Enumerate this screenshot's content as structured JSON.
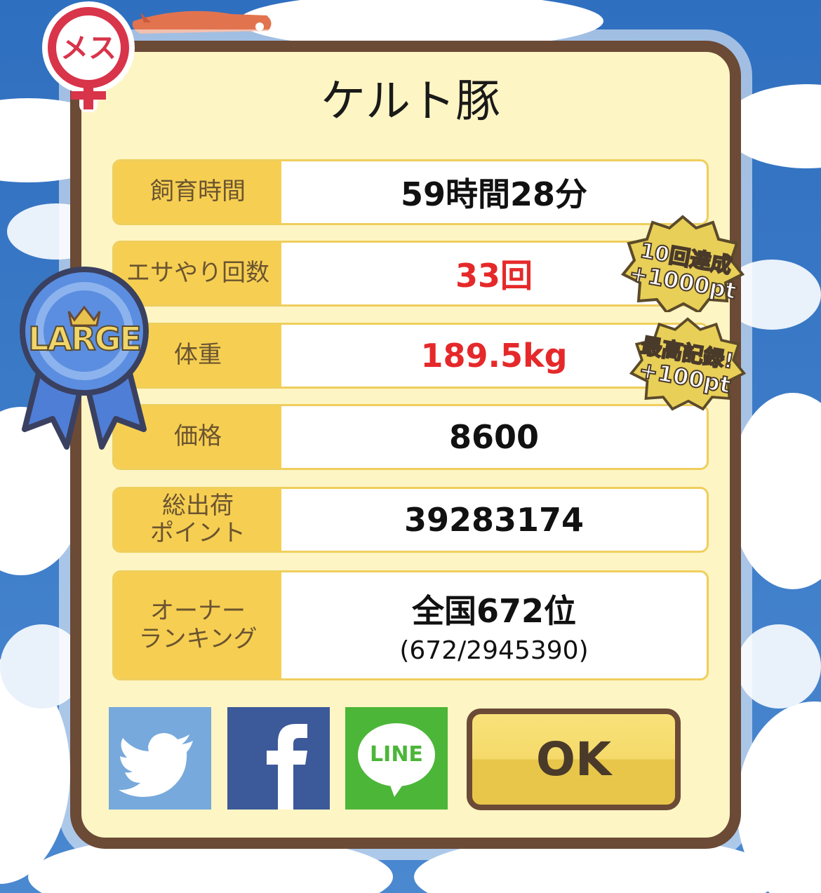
{
  "title": "ケルト豚",
  "gender_badge": "メス",
  "size_badge": "LARGE",
  "stats": [
    {
      "label": "飼育時間",
      "value": "59時間28分"
    },
    {
      "label": "エサやり回数",
      "value": "33回"
    },
    {
      "label": "体重",
      "value": "189.5kg"
    },
    {
      "label": "価格",
      "value": "8600"
    },
    {
      "label_line1": "総出荷",
      "label_line2": "ポイント",
      "value": "39283174"
    },
    {
      "label_line1": "オーナー",
      "label_line2": "ランキング",
      "value": "全国672位",
      "sub": "(672/2945390)"
    }
  ],
  "bonus_feed": {
    "line1": "10回達成",
    "line2": "+1000pt"
  },
  "bonus_weight": {
    "line1": "最高記録!",
    "line2": "+100pt"
  },
  "social": {
    "line": "LINE"
  },
  "ok_label": "OK",
  "colors": {
    "panel": "#fef5c4",
    "border": "#6b4a36",
    "label_bg": "#f6cf52",
    "highlight": "#e5292a",
    "twitter": "#77a9dc",
    "facebook": "#3c5a99",
    "line": "#4cb638"
  }
}
